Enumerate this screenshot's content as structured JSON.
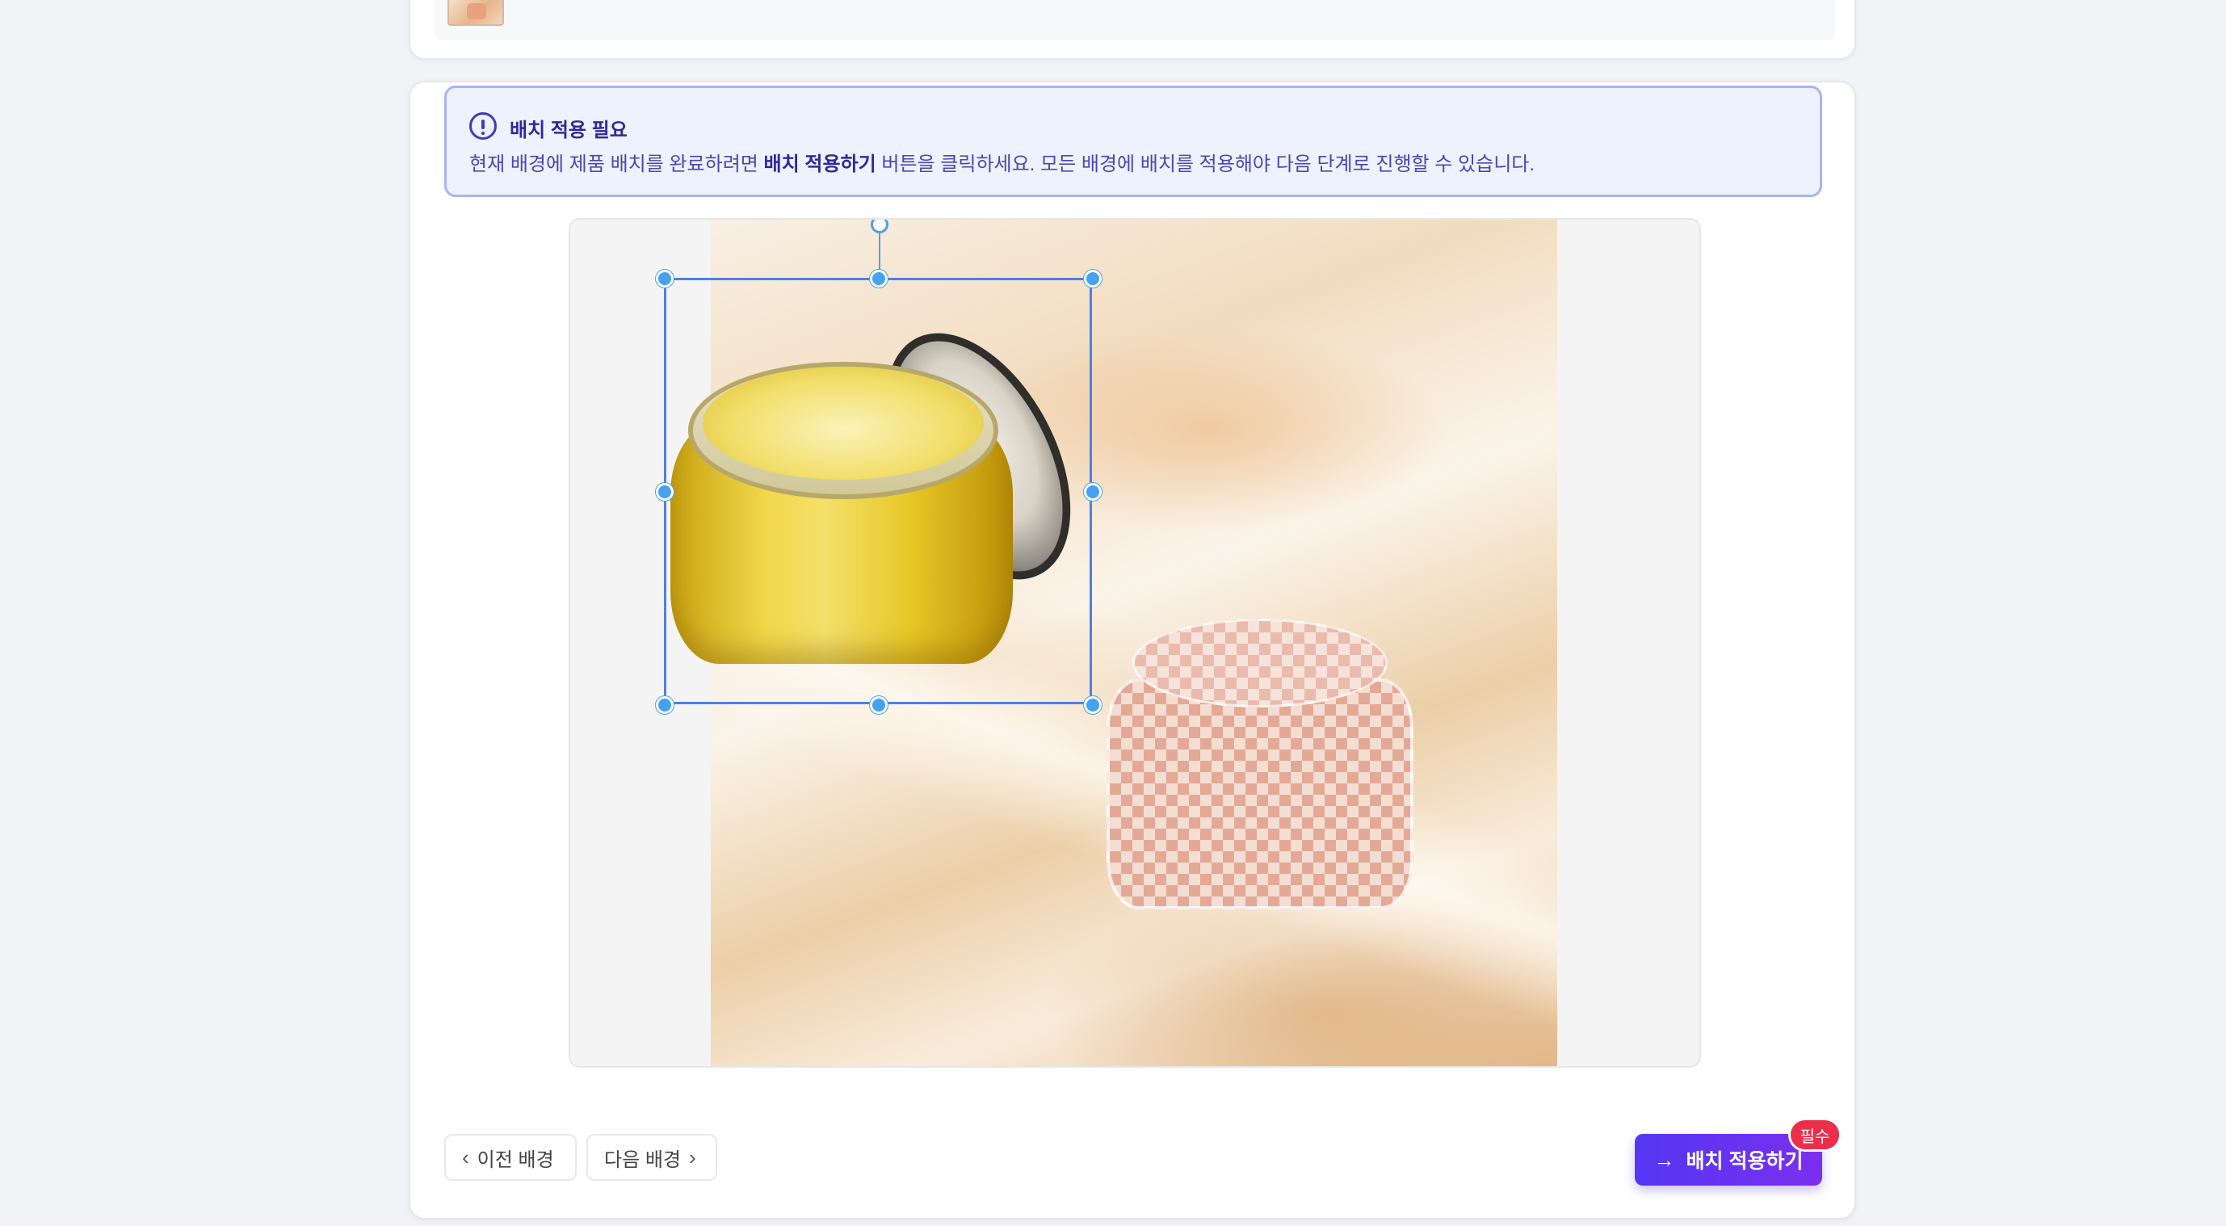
{
  "alert": {
    "title": "배치 적용 필요",
    "body_pre": "현재 배경에 제품 배치를 완료하려면 ",
    "body_bold": "배치 적용하기",
    "body_post": " 버튼을 클릭하세요. 모든 배경에 배치를 적용해야 다음 단계로 진행할 수 있습니다.",
    "icon": "alert-circle-icon"
  },
  "nav": {
    "prev_label": "이전 배경",
    "next_label": "다음 배경"
  },
  "apply": {
    "label": "배치 적용하기",
    "badge": "필수",
    "icon": "arrow-right-icon"
  },
  "colors": {
    "accent": "#5436f2",
    "accent_end": "#7b2ff0",
    "badge": "#ec2e4a",
    "alert_bg": "#eef1fe",
    "alert_border": "#a9b3f6",
    "selection": "#4f7fe6",
    "handle": "#44a2f0"
  }
}
